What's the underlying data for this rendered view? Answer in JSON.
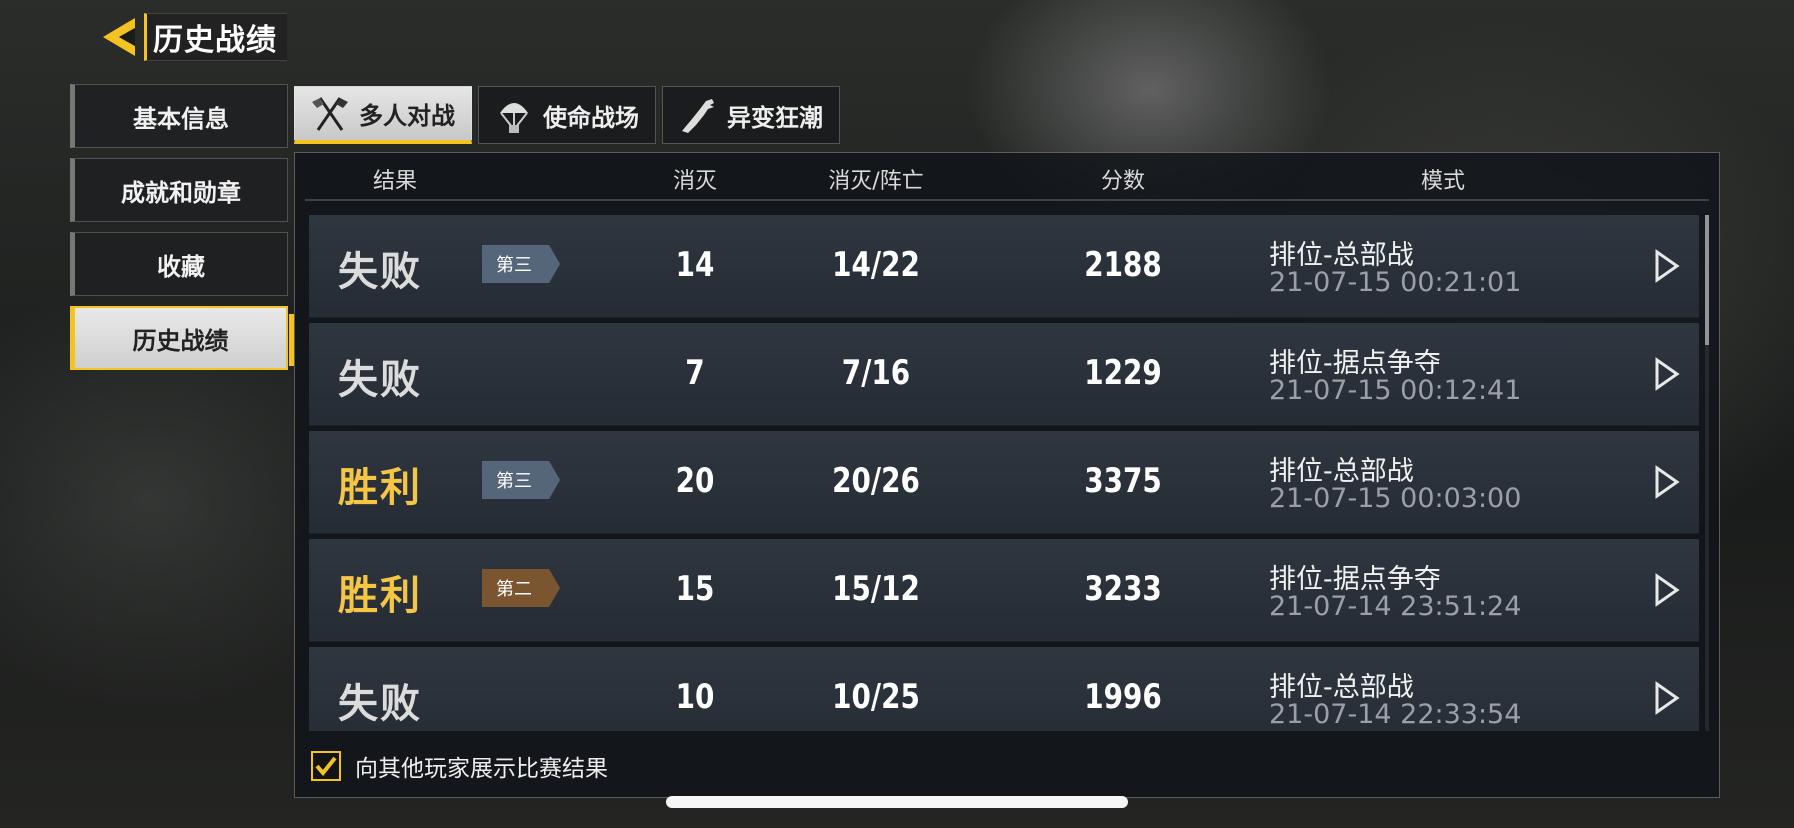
{
  "header": {
    "title": "历史战绩"
  },
  "sidebar": {
    "items": [
      {
        "label": "基本信息",
        "active": false
      },
      {
        "label": "成就和勋章",
        "active": false
      },
      {
        "label": "收藏",
        "active": false
      },
      {
        "label": "历史战绩",
        "active": true
      }
    ]
  },
  "tabs": [
    {
      "label": "多人对战",
      "icon": "crossed-flags-icon",
      "active": true
    },
    {
      "label": "使命战场",
      "icon": "parachute-icon",
      "active": false
    },
    {
      "label": "异变狂潮",
      "icon": "mutant-arm-icon",
      "active": false
    }
  ],
  "table": {
    "columns": [
      "结果",
      "消灭",
      "消灭/阵亡",
      "分数",
      "模式"
    ],
    "rows": [
      {
        "result": "失败",
        "win": false,
        "badge": "第三",
        "kills": "14",
        "kd": "14/22",
        "score": "2188",
        "mode": "排位-总部战",
        "time": "21-07-15 00:21:01"
      },
      {
        "result": "失败",
        "win": false,
        "badge": "",
        "kills": "7",
        "kd": "7/16",
        "score": "1229",
        "mode": "排位-据点争夺",
        "time": "21-07-15 00:12:41"
      },
      {
        "result": "胜利",
        "win": true,
        "badge": "第三",
        "kills": "20",
        "kd": "20/26",
        "score": "3375",
        "mode": "排位-总部战",
        "time": "21-07-15 00:03:00"
      },
      {
        "result": "胜利",
        "win": true,
        "badge": "第二",
        "kills": "15",
        "kd": "15/12",
        "score": "3233",
        "mode": "排位-据点争夺",
        "time": "21-07-14 23:51:24"
      },
      {
        "result": "失败",
        "win": false,
        "badge": "",
        "kills": "10",
        "kd": "10/25",
        "score": "1996",
        "mode": "排位-总部战",
        "time": "21-07-14 22:33:54"
      }
    ]
  },
  "footer": {
    "show_results_label": "向其他玩家展示比赛结果",
    "show_results_checked": true
  },
  "colors": {
    "accent": "#f3c322",
    "win": "#f5c543",
    "loss": "#dcdcdc",
    "badge_third": "#56667a",
    "badge_second": "#7a5530"
  }
}
